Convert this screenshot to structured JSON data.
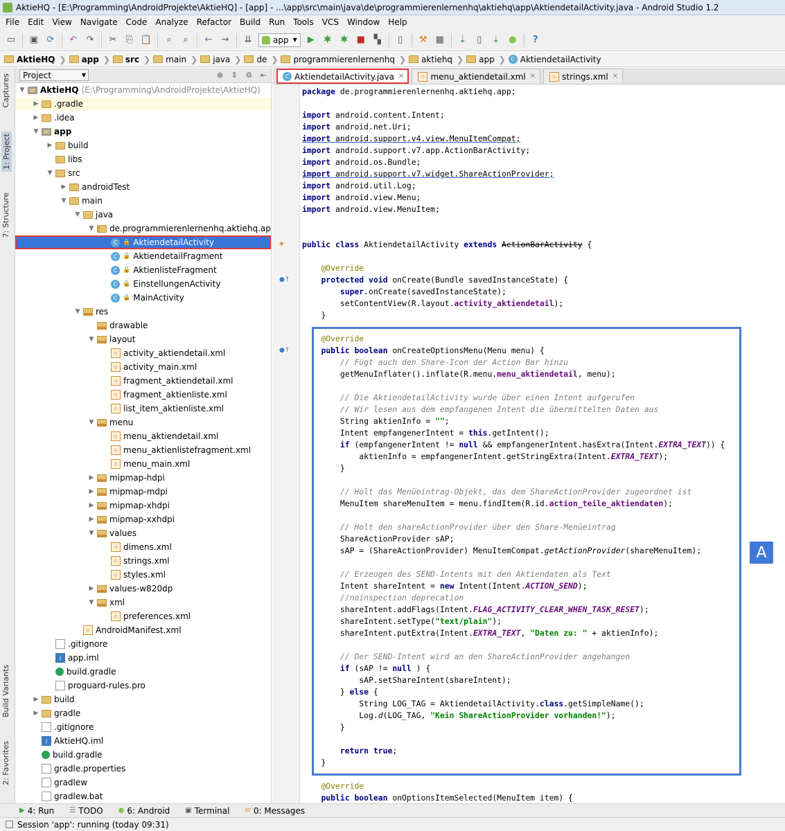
{
  "window": {
    "title": "AktieHQ - [E:\\Programming\\AndroidProjekte\\AktieHQ] - [app] - ...\\app\\src\\main\\java\\de\\programmierenlernenhq\\aktiehq\\app\\AktiendetailActivity.java - Android Studio 1.2"
  },
  "menu": [
    "File",
    "Edit",
    "View",
    "Navigate",
    "Code",
    "Analyze",
    "Refactor",
    "Build",
    "Run",
    "Tools",
    "VCS",
    "Window",
    "Help"
  ],
  "toolbar": {
    "run_config": "app"
  },
  "breadcrumb": [
    "AktieHQ",
    "app",
    "src",
    "main",
    "java",
    "de",
    "programmierenlernenhq",
    "aktiehq",
    "app",
    "AktiendetailActivity"
  ],
  "left_tools": {
    "captures": "Captures",
    "project": "1: Project",
    "structure": "7: Structure",
    "build_variants": "Build Variants",
    "favorites": "2: Favorites"
  },
  "project_panel": {
    "view": "Project"
  },
  "tree": [
    {
      "label": "AktieHQ",
      "path": "(E:\\Programming\\AndroidProjekte\\AktieHQ)",
      "depth": 0,
      "arrow": "▼",
      "icon": "module",
      "bold": true
    },
    {
      "label": ".gradle",
      "depth": 1,
      "arrow": "▶",
      "icon": "folder",
      "hl": true
    },
    {
      "label": ".idea",
      "depth": 1,
      "arrow": "▶",
      "icon": "folder"
    },
    {
      "label": "app",
      "depth": 1,
      "arrow": "▼",
      "icon": "module",
      "bold": true
    },
    {
      "label": "build",
      "depth": 2,
      "arrow": "▶",
      "icon": "folder"
    },
    {
      "label": "libs",
      "depth": 2,
      "arrow": "",
      "icon": "folder"
    },
    {
      "label": "src",
      "depth": 2,
      "arrow": "▼",
      "icon": "folder"
    },
    {
      "label": "androidTest",
      "depth": 3,
      "arrow": "▶",
      "icon": "folder"
    },
    {
      "label": "main",
      "depth": 3,
      "arrow": "▼",
      "icon": "folder"
    },
    {
      "label": "java",
      "depth": 4,
      "arrow": "▼",
      "icon": "folder"
    },
    {
      "label": "de.programmierenlernenhq.aktiehq.app",
      "depth": 5,
      "arrow": "▼",
      "icon": "pkg"
    },
    {
      "label": "AktiendetailActivity",
      "depth": 6,
      "arrow": "",
      "icon": "cls",
      "lock": true,
      "sel": true
    },
    {
      "label": "AktiendetailFragment",
      "depth": 6,
      "arrow": "",
      "icon": "cls",
      "lock": true
    },
    {
      "label": "AktienlisteFragment",
      "depth": 6,
      "arrow": "",
      "icon": "cls",
      "lock": true
    },
    {
      "label": "EinstellungenActivity",
      "depth": 6,
      "arrow": "",
      "icon": "cls",
      "lock": true
    },
    {
      "label": "MainActivity",
      "depth": 6,
      "arrow": "",
      "icon": "cls",
      "lock": true
    },
    {
      "label": "res",
      "depth": 4,
      "arrow": "▼",
      "icon": "res"
    },
    {
      "label": "drawable",
      "depth": 5,
      "arrow": "",
      "icon": "res"
    },
    {
      "label": "layout",
      "depth": 5,
      "arrow": "▼",
      "icon": "res"
    },
    {
      "label": "activity_aktiendetail.xml",
      "depth": 6,
      "arrow": "",
      "icon": "xml"
    },
    {
      "label": "activity_main.xml",
      "depth": 6,
      "arrow": "",
      "icon": "xml"
    },
    {
      "label": "fragment_aktiendetail.xml",
      "depth": 6,
      "arrow": "",
      "icon": "xml"
    },
    {
      "label": "fragment_aktienliste.xml",
      "depth": 6,
      "arrow": "",
      "icon": "xml"
    },
    {
      "label": "list_item_aktienliste.xml",
      "depth": 6,
      "arrow": "",
      "icon": "xml"
    },
    {
      "label": "menu",
      "depth": 5,
      "arrow": "▼",
      "icon": "res"
    },
    {
      "label": "menu_aktiendetail.xml",
      "depth": 6,
      "arrow": "",
      "icon": "xml"
    },
    {
      "label": "menu_aktienlistefragment.xml",
      "depth": 6,
      "arrow": "",
      "icon": "xml"
    },
    {
      "label": "menu_main.xml",
      "depth": 6,
      "arrow": "",
      "icon": "xml"
    },
    {
      "label": "mipmap-hdpi",
      "depth": 5,
      "arrow": "▶",
      "icon": "res"
    },
    {
      "label": "mipmap-mdpi",
      "depth": 5,
      "arrow": "▶",
      "icon": "res"
    },
    {
      "label": "mipmap-xhdpi",
      "depth": 5,
      "arrow": "▶",
      "icon": "res"
    },
    {
      "label": "mipmap-xxhdpi",
      "depth": 5,
      "arrow": "▶",
      "icon": "res"
    },
    {
      "label": "values",
      "depth": 5,
      "arrow": "▼",
      "icon": "res"
    },
    {
      "label": "dimens.xml",
      "depth": 6,
      "arrow": "",
      "icon": "xml"
    },
    {
      "label": "strings.xml",
      "depth": 6,
      "arrow": "",
      "icon": "xml"
    },
    {
      "label": "styles.xml",
      "depth": 6,
      "arrow": "",
      "icon": "xml"
    },
    {
      "label": "values-w820dp",
      "depth": 5,
      "arrow": "▶",
      "icon": "res"
    },
    {
      "label": "xml",
      "depth": 5,
      "arrow": "▼",
      "icon": "res"
    },
    {
      "label": "preferences.xml",
      "depth": 6,
      "arrow": "",
      "icon": "xml"
    },
    {
      "label": "AndroidManifest.xml",
      "depth": 4,
      "arrow": "",
      "icon": "xml"
    },
    {
      "label": ".gitignore",
      "depth": 2,
      "arrow": "",
      "icon": "file"
    },
    {
      "label": "app.iml",
      "depth": 2,
      "arrow": "",
      "icon": "iml"
    },
    {
      "label": "build.gradle",
      "depth": 2,
      "arrow": "",
      "icon": "gradle"
    },
    {
      "label": "proguard-rules.pro",
      "depth": 2,
      "arrow": "",
      "icon": "file"
    },
    {
      "label": "build",
      "depth": 1,
      "arrow": "▶",
      "icon": "folder"
    },
    {
      "label": "gradle",
      "depth": 1,
      "arrow": "▶",
      "icon": "folder"
    },
    {
      "label": ".gitignore",
      "depth": 1,
      "arrow": "",
      "icon": "file"
    },
    {
      "label": "AktieHQ.iml",
      "depth": 1,
      "arrow": "",
      "icon": "iml"
    },
    {
      "label": "build.gradle",
      "depth": 1,
      "arrow": "",
      "icon": "gradle"
    },
    {
      "label": "gradle.properties",
      "depth": 1,
      "arrow": "",
      "icon": "file"
    },
    {
      "label": "gradlew",
      "depth": 1,
      "arrow": "",
      "icon": "file"
    },
    {
      "label": "gradlew.bat",
      "depth": 1,
      "arrow": "",
      "icon": "file"
    }
  ],
  "tabs": [
    {
      "label": "AktiendetailActivity.java",
      "type": "cls",
      "active": true
    },
    {
      "label": "menu_aktiendetail.xml",
      "type": "xml",
      "active": false
    },
    {
      "label": "strings.xml",
      "type": "xml",
      "active": false
    }
  ],
  "code": [
    [
      [
        "package de.programmierenlernenhq.aktiehq.app;",
        "kw0"
      ]
    ],
    [],
    [
      [
        "import",
        "kw"
      ],
      [
        " android.content.Intent;",
        ""
      ]
    ],
    [
      [
        "import",
        "kw"
      ],
      [
        " android.net.Uri;",
        ""
      ]
    ],
    [
      [
        "import android.support.v4.view.MenuItemCompat;",
        "ul"
      ]
    ],
    [
      [
        "import",
        "kw"
      ],
      [
        " android.support.v7.app.ActionBarActivity;",
        ""
      ]
    ],
    [
      [
        "import",
        "kw"
      ],
      [
        " android.os.Bundle;",
        ""
      ]
    ],
    [
      [
        "import android.support.v7.widget.ShareActionProvider;",
        "ul"
      ]
    ],
    [
      [
        "import",
        "kw"
      ],
      [
        " android.util.Log;",
        ""
      ]
    ],
    [
      [
        "import",
        "kw"
      ],
      [
        " android.view.Menu;",
        ""
      ]
    ],
    [
      [
        "import",
        "kw"
      ],
      [
        " android.view.MenuItem;",
        ""
      ]
    ],
    [],
    [],
    [
      [
        "public class ",
        "kw"
      ],
      [
        "AktiendetailActivity ",
        ""
      ],
      [
        "extends ",
        "kw"
      ],
      [
        "ActionBarActivity",
        "strike"
      ],
      [
        " {",
        ""
      ]
    ],
    [],
    [
      [
        "    ",
        ""
      ],
      [
        "@Override",
        "ann"
      ]
    ],
    [
      [
        "    ",
        ""
      ],
      [
        "protected void ",
        "kw"
      ],
      [
        "onCreate(Bundle savedInstanceState) {",
        ""
      ]
    ],
    [
      [
        "        ",
        ""
      ],
      [
        "super",
        "kw"
      ],
      [
        ".onCreate(savedInstanceState);",
        ""
      ]
    ],
    [
      [
        "        setContentView(R.layout.",
        ""
      ],
      [
        "activity_aktiendetail",
        "rfld"
      ],
      [
        ");",
        ""
      ]
    ],
    [
      [
        "    }",
        ""
      ]
    ],
    [],
    [
      [
        "    ",
        ""
      ],
      [
        "@Override",
        "ann"
      ]
    ],
    [
      [
        "    ",
        ""
      ],
      [
        "public boolean ",
        "kw"
      ],
      [
        "onCreateOptionsMenu(Menu menu) {",
        ""
      ]
    ],
    [
      [
        "        ",
        ""
      ],
      [
        "// Fügt auch den Share-Icon der Action Bar hinzu",
        "cm"
      ]
    ],
    [
      [
        "        getMenuInflater().inflate(R.menu.",
        ""
      ],
      [
        "menu_aktiendetail",
        "rfld"
      ],
      [
        ", menu);",
        ""
      ]
    ],
    [],
    [
      [
        "        ",
        ""
      ],
      [
        "// Die AktiendetailActivity wurde über einen Intent aufgerufen",
        "cm"
      ]
    ],
    [
      [
        "        ",
        ""
      ],
      [
        "// Wir lesen aus dem empfangenen Intent die übermittelten Daten aus",
        "cm"
      ]
    ],
    [
      [
        "        String aktienInfo = ",
        ""
      ],
      [
        "\"\"",
        "str"
      ],
      [
        ";",
        ""
      ]
    ],
    [
      [
        "        Intent empfangenerIntent = ",
        ""
      ],
      [
        "this",
        "kw"
      ],
      [
        ".getIntent();",
        ""
      ]
    ],
    [
      [
        "        ",
        ""
      ],
      [
        "if ",
        "kw"
      ],
      [
        "(empfangenerIntent != ",
        ""
      ],
      [
        "null ",
        "kw"
      ],
      [
        "&& empfangenerIntent.hasExtra(Intent.",
        ""
      ],
      [
        "EXTRA_TEXT",
        "fld"
      ],
      [
        ")) {",
        ""
      ]
    ],
    [
      [
        "            aktienInfo = empfangenerIntent.getStringExtra(Intent.",
        ""
      ],
      [
        "EXTRA_TEXT",
        "fld"
      ],
      [
        ");",
        ""
      ]
    ],
    [
      [
        "        }",
        ""
      ]
    ],
    [],
    [
      [
        "        ",
        ""
      ],
      [
        "// Holt das Menüeintrag-Objekt, das dem ShareActionProvider zugeordnet ist",
        "cm"
      ]
    ],
    [
      [
        "        MenuItem shareMenuItem = menu.findItem(R.id.",
        ""
      ],
      [
        "action_teile_aktiendaten",
        "rfld"
      ],
      [
        ");",
        ""
      ]
    ],
    [],
    [
      [
        "        ",
        ""
      ],
      [
        "// Holt den shareActionProvider über den Share-Menüeintrag",
        "cm"
      ]
    ],
    [
      [
        "        ShareActionProvider sAP;",
        ""
      ]
    ],
    [
      [
        "        sAP = (ShareActionProvider) MenuItemCompat.",
        ""
      ],
      [
        "getActionProvider",
        "itm"
      ],
      [
        "(shareMenuItem);",
        ""
      ]
    ],
    [],
    [
      [
        "        ",
        ""
      ],
      [
        "// Erzeugen des SEND-Intents mit den Aktiendaten als Text",
        "cm"
      ]
    ],
    [
      [
        "        Intent shareIntent = ",
        ""
      ],
      [
        "new ",
        "kw"
      ],
      [
        "Intent(Intent.",
        ""
      ],
      [
        "ACTION_SEND",
        "fld"
      ],
      [
        ");",
        ""
      ]
    ],
    [
      [
        "        ",
        ""
      ],
      [
        "//noinspection deprecation",
        "cm"
      ]
    ],
    [
      [
        "        shareIntent.addFlags(Intent.",
        ""
      ],
      [
        "FLAG_ACTIVITY_CLEAR_WHEN_TASK_RESET",
        "fld"
      ],
      [
        ");",
        ""
      ]
    ],
    [
      [
        "        shareIntent.setType(",
        ""
      ],
      [
        "\"text/plain\"",
        "str"
      ],
      [
        ");",
        ""
      ]
    ],
    [
      [
        "        shareIntent.putExtra(Intent.",
        ""
      ],
      [
        "EXTRA_TEXT",
        "fld"
      ],
      [
        ", ",
        ""
      ],
      [
        "\"Daten zu: \"",
        "str"
      ],
      [
        " + aktienInfo);",
        ""
      ]
    ],
    [],
    [
      [
        "        ",
        ""
      ],
      [
        "// Der SEND-Intent wird an den ShareActionProvider angehangen",
        "cm"
      ]
    ],
    [
      [
        "        ",
        ""
      ],
      [
        "if ",
        "kw"
      ],
      [
        "(sAP != ",
        ""
      ],
      [
        "null ",
        "kw"
      ],
      [
        ") {",
        ""
      ]
    ],
    [
      [
        "            sAP.setShareIntent(shareIntent);",
        ""
      ]
    ],
    [
      [
        "        } ",
        ""
      ],
      [
        "else ",
        "kw"
      ],
      [
        "{",
        ""
      ]
    ],
    [
      [
        "            String LOG_TAG = AktiendetailActivity.",
        ""
      ],
      [
        "class",
        "kw"
      ],
      [
        ".getSimpleName();",
        ""
      ]
    ],
    [
      [
        "            Log.",
        ""
      ],
      [
        "d",
        "itm"
      ],
      [
        "(LOG_TAG, ",
        ""
      ],
      [
        "\"Kein ShareActionProvider vorhanden!\"",
        "str"
      ],
      [
        ");",
        ""
      ]
    ],
    [
      [
        "        }",
        ""
      ]
    ],
    [],
    [
      [
        "        ",
        ""
      ],
      [
        "return true",
        "kw"
      ],
      [
        ";",
        ""
      ]
    ],
    [
      [
        "    }",
        ""
      ]
    ],
    [],
    [
      [
        "    ",
        ""
      ],
      [
        "@Override",
        "ann"
      ]
    ],
    [
      [
        "    ",
        ""
      ],
      [
        "public boolean ",
        "kw"
      ],
      [
        "onOptionsItemSelected(MenuItem item) {",
        ""
      ]
    ]
  ],
  "annotation_label": "A",
  "bottom_tools": [
    {
      "label": "4: Run",
      "icon": "▶",
      "color": "#3c9a3c"
    },
    {
      "label": "TODO",
      "icon": "☰",
      "color": "#777777"
    },
    {
      "label": "6: Android",
      "icon": "●",
      "color": "#8bc34a"
    },
    {
      "label": "Terminal",
      "icon": "▣",
      "color": "#555555"
    },
    {
      "label": "0: Messages",
      "icon": "✉",
      "color": "#d8a13a"
    }
  ],
  "status": "Session 'app': running (today 09:31)"
}
